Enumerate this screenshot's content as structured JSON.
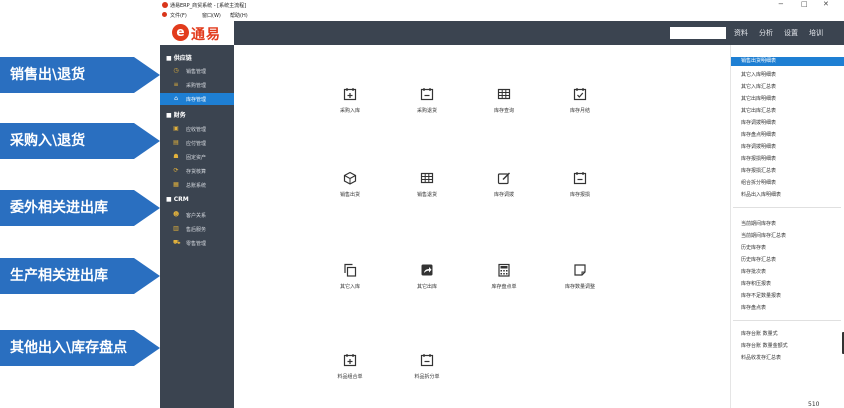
{
  "callouts": [
    "销售出\\退货",
    "采购入\\退货",
    "委外相关进出库",
    "生产相关进出库",
    "其他出入\\库存盘点"
  ],
  "window": {
    "title": "通易ERP_商贸系统 - [系统主流程]",
    "min": "−",
    "max": "□",
    "close": "✕"
  },
  "menu": [
    "文件(F)",
    "窗口(W)",
    "帮助(H)"
  ],
  "header": {
    "logo_mark": "e",
    "logo_text": "通易",
    "search_value": "",
    "menu": [
      "资料",
      "分析",
      "设置",
      "培训"
    ]
  },
  "sidebar": {
    "sections": [
      "■ 供应链",
      "■ 财务",
      "■ CRM"
    ],
    "items": [
      "销售管理",
      "采购管理",
      "库存管理",
      "应收管理",
      "应付管理",
      "固定资产",
      "存货核算",
      "总账系统",
      "客户关系",
      "售后服务",
      "零售管理"
    ]
  },
  "tiles": [
    "采购入库",
    "采购退货",
    "库存查询",
    "库存月结",
    "销售出货",
    "销售退货",
    "库存调拨",
    "库存报损",
    "其它入库",
    "其它出库",
    "库存盘点单",
    "库存数量调整",
    "料品组合单",
    "料品拆分单"
  ],
  "reports": {
    "group1": [
      "销售出货明细表",
      "其它入库明细表",
      "其它入库汇总表",
      "其它出库明细表",
      "其它出库汇总表",
      "库存调拨明细表",
      "库存盘点明细表",
      "库存调拨明细表",
      "库存报损明细表",
      "库存报损汇总表",
      "组合拆分明细表",
      "料品出入库明细表"
    ],
    "group2": [
      "当前期间库存表",
      "当前期间库存汇总表",
      "历史库存表",
      "历史库存汇总表",
      "库存批次表",
      "库存积压报表",
      "库存不足数量报表",
      "库存盘点表"
    ],
    "group3": [
      "库存台账 数量式",
      "库存台账 数量金额式",
      "料品收发存汇总表"
    ]
  },
  "page_number": "510"
}
